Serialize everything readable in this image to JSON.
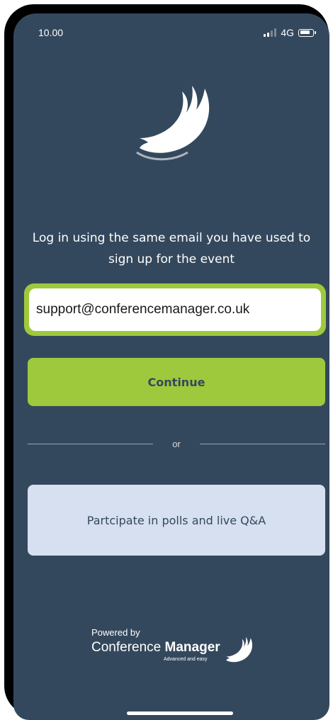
{
  "status_bar": {
    "time": "10.00",
    "network": "4G",
    "battery_level": 0.85
  },
  "login": {
    "instruction": "Log in using the same email you have used to sign up for the event",
    "email_value": "support@conferencemanager.co.uk",
    "continue_label": "Continue",
    "divider_text": "or",
    "polls_label": "Partcipate in polls and live Q&A"
  },
  "footer": {
    "powered_by": "Powered by",
    "brand_light": "Conference ",
    "brand_bold": "Manager",
    "tagline": "Advanced and easy"
  },
  "colors": {
    "background": "#34485d",
    "accent_green": "#9ec93c",
    "polls_button": "#d6e0f1",
    "text_dark": "#34485d"
  },
  "icons": [
    "signal-icon",
    "battery-icon",
    "app-logo-icon"
  ]
}
